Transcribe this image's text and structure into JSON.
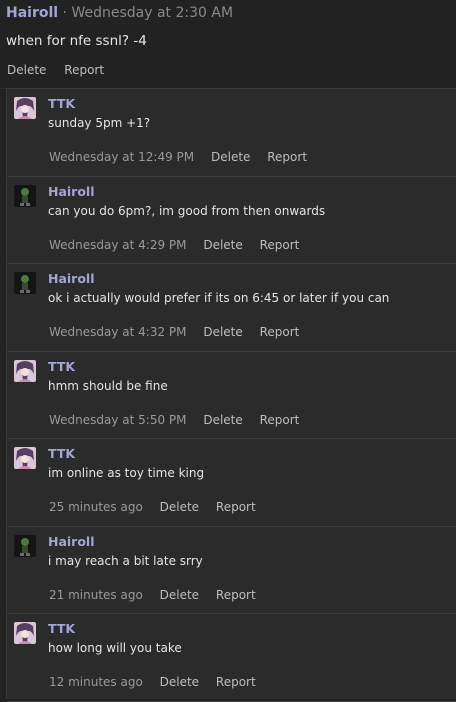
{
  "post": {
    "author": "Hairoll",
    "separator": "·",
    "time": "Wednesday at 2:30 AM",
    "body": "when for nfe ssnl? -4",
    "actions": {
      "delete": "Delete",
      "report": "Report"
    }
  },
  "comments": [
    {
      "author": "TTK",
      "avatar": "avatar-ttk",
      "text": "sunday 5pm +1?",
      "time": "Wednesday at 12:49 PM",
      "delete": "Delete",
      "report": "Report"
    },
    {
      "author": "Hairoll",
      "avatar": "avatar-hairoll",
      "text": "can you do 6pm?, im good from then onwards",
      "time": "Wednesday at 4:29 PM",
      "delete": "Delete",
      "report": "Report"
    },
    {
      "author": "Hairoll",
      "avatar": "avatar-hairoll",
      "text": "ok i actually would prefer if its on 6:45 or later if you can",
      "time": "Wednesday at 4:32 PM",
      "delete": "Delete",
      "report": "Report"
    },
    {
      "author": "TTK",
      "avatar": "avatar-ttk",
      "text": "hmm should be fine",
      "time": "Wednesday at 5:50 PM",
      "delete": "Delete",
      "report": "Report"
    },
    {
      "author": "TTK",
      "avatar": "avatar-ttk",
      "text": "im online as toy time king",
      "time": "25 minutes ago",
      "delete": "Delete",
      "report": "Report"
    },
    {
      "author": "Hairoll",
      "avatar": "avatar-hairoll",
      "text": "i may reach a bit late srry",
      "time": "21 minutes ago",
      "delete": "Delete",
      "report": "Report"
    },
    {
      "author": "TTK",
      "avatar": "avatar-ttk",
      "text": "how long will you take",
      "time": "12 minutes ago",
      "delete": "Delete",
      "report": "Report"
    }
  ],
  "colors": {
    "username": "#a3a4d8",
    "background": "#2b2b2b",
    "muted": "#9a9a9a"
  }
}
